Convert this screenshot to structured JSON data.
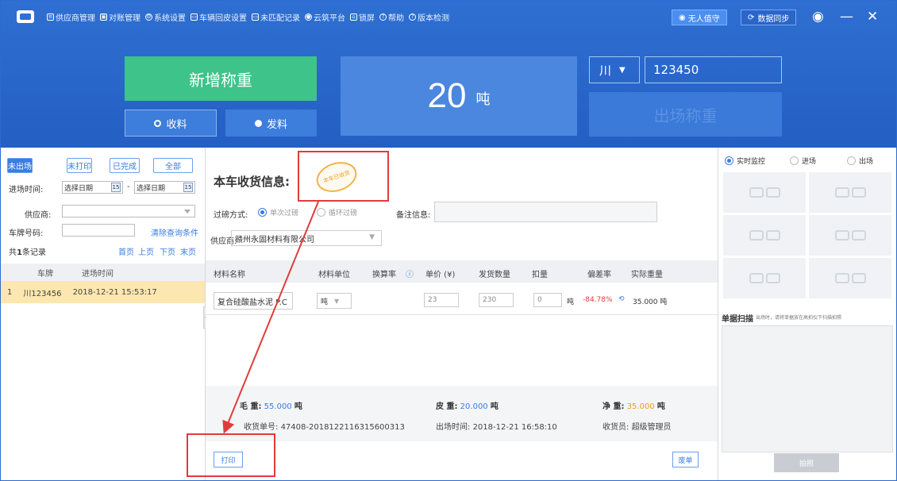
{
  "menubar": {
    "items": [
      "供应商管理",
      "对账管理",
      "系统设置",
      "车辆回皮设置",
      "未匹配记录",
      "云筑平台",
      "锁屏",
      "帮助",
      "版本检测"
    ],
    "unattended_label": "无人值守",
    "sync_label": "数据同步"
  },
  "scale": {
    "new_weigh_label": "新增称重",
    "tab_receive": "收料",
    "tab_send": "发料",
    "weight_value": "20",
    "weight_unit": "吨",
    "plate_province": "川",
    "plate_number": "123450",
    "exit_weigh_label": "出场称重"
  },
  "filter": {
    "chips": [
      "未出场",
      "未打印",
      "已完成",
      "全部"
    ],
    "entry_time_label": "进场时间:",
    "date_placeholder": "选择日期",
    "date_sep": "-",
    "calendar_num": "15",
    "supplier_label": "供应商:",
    "plate_label": "车牌号码:",
    "clear_label": "清除查询条件",
    "record_count_prefix": "共",
    "record_count": "1",
    "record_count_suffix": "条记录",
    "pager": [
      "首页",
      "上页",
      "下页",
      "末页"
    ],
    "col_plate": "车牌",
    "col_time": "进场时间",
    "rows": [
      {
        "index": "1",
        "plate": "川123456",
        "time": "2018-12-21 15:53:17"
      }
    ]
  },
  "detail": {
    "title": "本车收货信息:",
    "stamp_text": "本车已收货",
    "weigh_mode_label": "过磅方式:",
    "mode_single": "单次过磅",
    "mode_cycle": "循环过磅",
    "note_label": "备注信息:",
    "supplier_label": "供应商:",
    "supplier_value": "赣州永固材料有限公司",
    "columns": [
      "材料名称",
      "材料单位",
      "换算率",
      "单价 (¥)",
      "发货数量",
      "扣量",
      "偏差率",
      "实际重量"
    ],
    "row": {
      "material": "复合硅酸盐水泥 P.C",
      "unit": "吨",
      "price": "23",
      "quantity": "230",
      "deduct": "0",
      "deduct_unit": "吨",
      "deviation": "-84.78%",
      "actual_weight": "35.000 吨"
    },
    "gross_label": "毛  重:",
    "gross_value": "55.000",
    "tare_label": "皮  重:",
    "tare_value": "20.000",
    "net_label": "净  重:",
    "net_value": "35.000",
    "ton": "吨",
    "receipt_label": "收货单号:",
    "receipt_value": "47408-2018122116315600313",
    "exit_time_label": "出场时间:",
    "exit_time_value": "2018-12-21 16:58:10",
    "receiver_label": "收货员:",
    "receiver_value": "超级管理员",
    "print_label": "打印",
    "void_label": "废单"
  },
  "right": {
    "monitor_label": "实时监控",
    "enter_label": "进场",
    "exit_label": "出场",
    "scan_title": "单据扫描",
    "scan_hint": "出场时，请将单据放在高拍仪下扫描拍照",
    "shoot_label": "拍照"
  },
  "colors": {
    "header_blue": "#2f6fd2",
    "new_green": "#3ec38a",
    "accent_blue": "#3a7ce0",
    "selected_row": "#fde7b0",
    "annotation_red": "#e23b3b",
    "deviation_red": "#e23b3b",
    "weight_orange": "#f29a1d"
  }
}
